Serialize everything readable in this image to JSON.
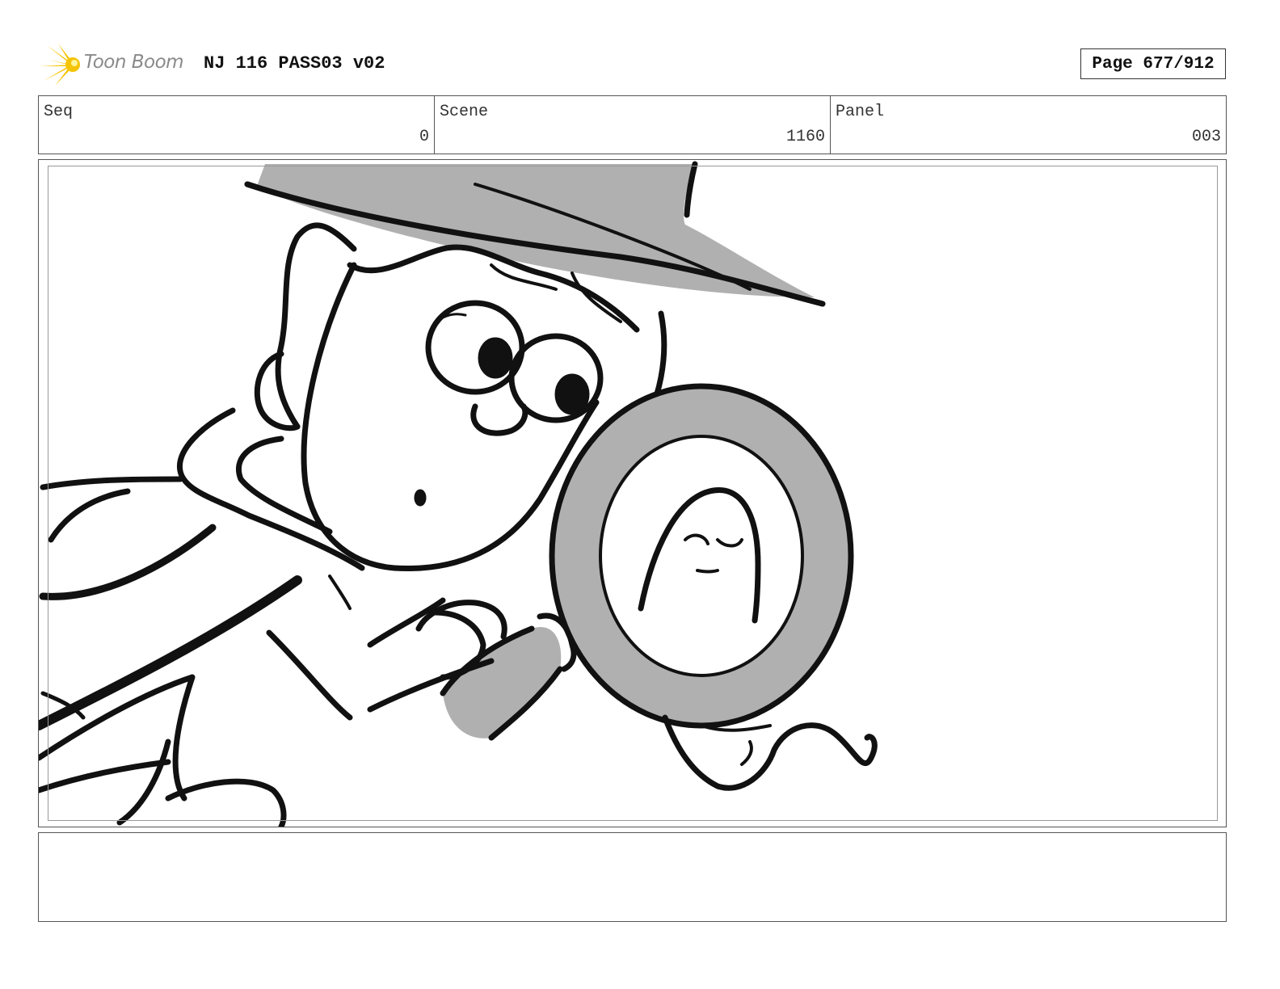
{
  "header": {
    "logo_text": "Toon Boom",
    "title": "NJ 116 PASS03 v02",
    "page_label": "Page 677/912"
  },
  "meta": {
    "seq_label": "Seq",
    "seq_value": "0",
    "scene_label": "Scene",
    "scene_value": "1160",
    "panel_label": "Panel",
    "panel_value": "003"
  },
  "notes": {
    "text": ""
  },
  "colors": {
    "logo_yellow": "#f5c400",
    "sketch_gray": "#b0b0b0",
    "ink": "#111111"
  },
  "icons": {
    "logo": "toon-boom-star-icon"
  }
}
